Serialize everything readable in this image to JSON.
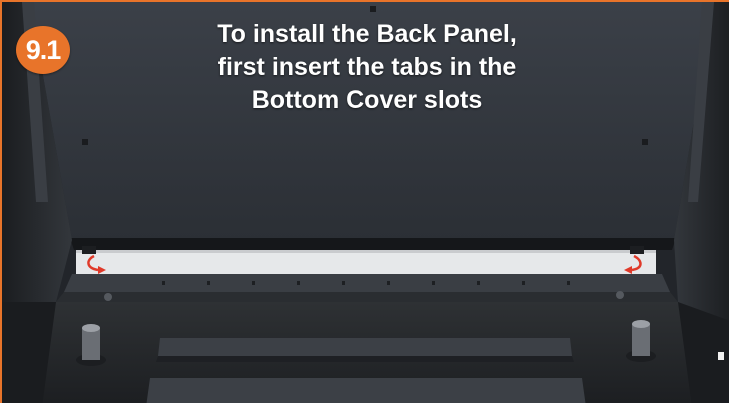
{
  "step": {
    "number": "9.1",
    "badge_color": "#e8742a"
  },
  "instruction": {
    "lines": [
      "To install the Back Panel,",
      "first insert the tabs in the",
      "Bottom Cover slots"
    ]
  },
  "colors": {
    "frame_accent": "#e8742a",
    "panel": "#30343a",
    "arrow": "#e03a2a"
  },
  "icons": [
    "left-insert-arrow-icon",
    "right-insert-arrow-icon"
  ]
}
